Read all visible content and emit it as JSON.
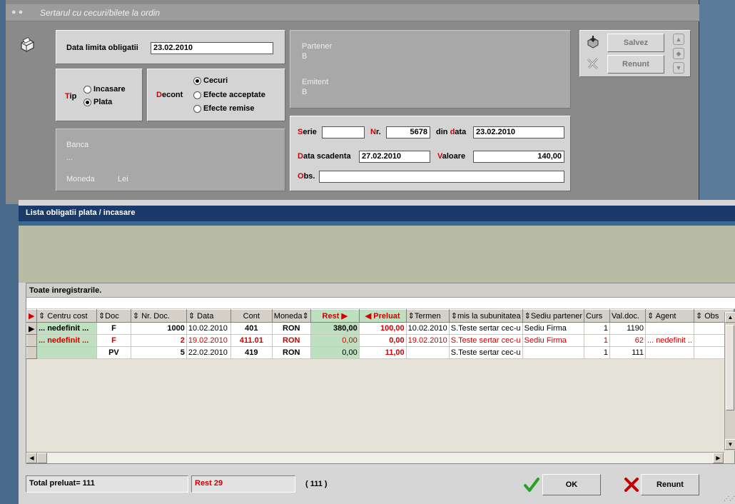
{
  "colors": {
    "accent_red": "#d00000",
    "title_bar": "#1a3a6a",
    "highlight_green": "#bfe0c0"
  },
  "main_window": {
    "title": "Sertarul cu cecuri/bilete la ordin",
    "data_limita_label": "Data limita obligatii",
    "data_limita_value": "23.02.2010",
    "tip_label": "Tip",
    "tip_options": [
      "Incasare",
      "Plata"
    ],
    "tip_selected": "Plata",
    "decont_label": "Decont",
    "decont_options": [
      "Cecuri",
      "Efecte acceptate",
      "Efecte remise"
    ],
    "decont_selected": "Cecuri",
    "partener_label": "Partener",
    "partener_value": "B",
    "emitent_label": "Emitent",
    "emitent_value": "B",
    "banca_label": "Banca",
    "banca_value": "...",
    "moneda_label": "Moneda",
    "moneda_value": "Lei",
    "serie_label": "Serie",
    "serie_value": "",
    "nr_label": "Nr.",
    "nr_value": "5678",
    "din_data_label": "din data",
    "din_data_value": "23.02.2010",
    "data_scadenta_label": "Data scadenta",
    "data_scadenta_value": "27.02.2010",
    "valoare_label": "Valoare",
    "valoare_value": "140,00",
    "obs_label": "Obs.",
    "obs_value": "",
    "save_label": "Salvez",
    "cancel_label": "Renunt"
  },
  "list_window": {
    "title": "Lista obligatii plata / incasare",
    "grid_caption": "Toate inregistrarile.",
    "columns": [
      "Centru cost",
      "Doc",
      "Nr. Doc.",
      "Data",
      "Cont",
      "Moneda",
      "Rest",
      "Preluat",
      "Termen",
      "mis la subunitatea",
      "Sediu partener",
      "Curs",
      "Val.doc.",
      "Agent",
      "Obs"
    ],
    "rows": [
      [
        "... nedefinit ...",
        "F",
        "1000",
        "10.02.2010",
        "401",
        "RON",
        "380,00",
        "100,00",
        "10.02.2010",
        "S.Teste sertar cec-u",
        "Sediu Firma",
        "1",
        "1190",
        "",
        ""
      ],
      [
        "... nedefinit ...",
        "F",
        "2",
        "19.02.2010",
        "411.01",
        "RON",
        "0,00",
        "0,00",
        "19.02.2010",
        "S.Teste sertar cec-u",
        "Sediu Firma",
        "1",
        "62",
        "... nedefinit ..",
        ""
      ],
      [
        "",
        "PV",
        "5",
        "22.02.2010",
        "419",
        "RON",
        "0,00",
        "11,00",
        "",
        "S.Teste sertar cec-u",
        "",
        "1",
        "111",
        "",
        ""
      ]
    ],
    "total_preluat": "Total preluat= 111",
    "rest_total": "Rest 29",
    "count": "( 111 )",
    "ok_label": "OK",
    "renunt_label": "Renunt"
  }
}
